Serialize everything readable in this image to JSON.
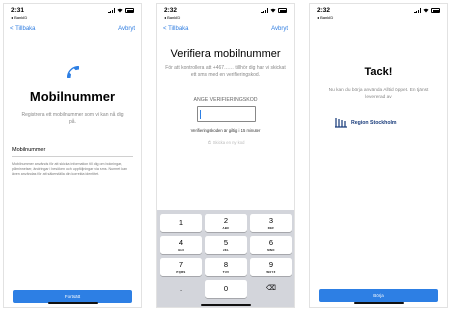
{
  "colors": {
    "accent": "#2d7fe4",
    "logo_blue": "#1a3d7c",
    "keypad_bg": "#d3d5db"
  },
  "screens": [
    {
      "status": {
        "time": "2:31",
        "back_app": "◂ BankID"
      },
      "nav": {
        "back_label": "< Tillbaka",
        "cancel_label": "Avbryt"
      },
      "icon": "phone-icon",
      "title": "Mobilnummer",
      "subtitle": "Registrera ett mobilnummer som vi kan nå dig på.",
      "field_label": "Mobilnummer",
      "note": "Mobilnummer används för att skicka information till dig om bokningar, påminnelser, ändringar i besöken och uppföljningar via sms. Numret kan även användas för att säkerställa din korrekta identitet.",
      "button_label": "Fortsätt"
    },
    {
      "status": {
        "time": "2:32",
        "back_app": "◂ BankID"
      },
      "nav": {
        "back_label": "< Tillbaka",
        "cancel_label": "Avbryt"
      },
      "title": "Verifiera mobilnummer",
      "subtitle": "För att kontrollera att +467…… tillhör dig har vi skickat ett sms med en verifieringskod.",
      "code_label": "ANGE VERIFIERINGSKOD",
      "validity": "Verifieringskoden är giltig i 15 minuter",
      "resend": "Skicka en ny kod",
      "keys": [
        {
          "digit": "1",
          "letters": ""
        },
        {
          "digit": "2",
          "letters": "ABC"
        },
        {
          "digit": "3",
          "letters": "DEF"
        },
        {
          "digit": "4",
          "letters": "GHI"
        },
        {
          "digit": "5",
          "letters": "JKL"
        },
        {
          "digit": "6",
          "letters": "MNO"
        },
        {
          "digit": "7",
          "letters": "PQRS"
        },
        {
          "digit": "8",
          "letters": "TUV"
        },
        {
          "digit": "9",
          "letters": "WXYZ"
        },
        {
          "digit": ".",
          "letters": ""
        },
        {
          "digit": "0",
          "letters": ""
        },
        {
          "digit": "⌫",
          "letters": ""
        }
      ]
    },
    {
      "status": {
        "time": "2:32",
        "back_app": "◂ BankID"
      },
      "title": "Tack!",
      "subtitle": "Nu kan du börja använda Alltid öppet. En tjänst levererad av",
      "logo_text": "Region Stockholm",
      "button_label": "Börja"
    }
  ]
}
